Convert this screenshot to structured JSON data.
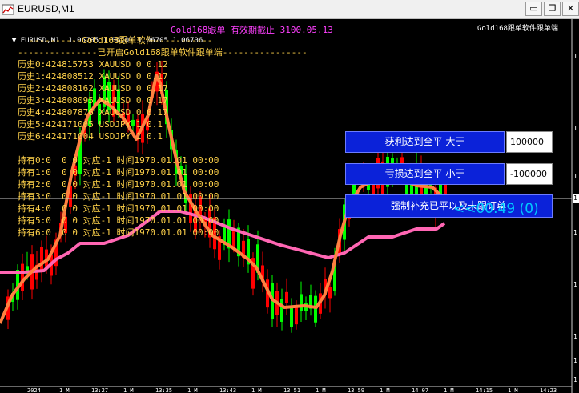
{
  "window": {
    "title": "EURUSD,M1",
    "minimize_glyph": "▭",
    "restore_glyph": "❐",
    "close_glyph": "✕"
  },
  "chart_header": {
    "symbol_info": "EURUSD,M1  1.06705 1.06707 1.06705 1.06706",
    "product_banner": "Gold168跟单 有效期截止 3100.05.13",
    "ea_name": "Gold168跟单软件跟单端"
  },
  "overlay_lines": [
    "----------Gold168跟单软件-----------",
    "---------------已开启Gold168跟单软件跟单端----------------",
    "历史0:424815753 XAUUSD 0 0.12",
    "历史1:424808512 XAUUSD 0 0.17",
    "历史2:424808162 XAUUSD 0 0.17",
    "历史3:424808095 XAUUSD 0 0.17",
    "历史4:424807876 XAUUSD 0 0.17",
    "历史5:424171005 USDJPY 1 0.1",
    "历史6:424171004 USDJPY 1 0.1",
    "",
    "持有0:0  0 0 对应-1 时间1970.01.01 00:00",
    "持有1:0  0 0 对应-1 时间1970.01.01 00:00",
    "持有2:0  0 0 对应-1 时间1970.01.01 00:00",
    "持有3:0  0 0 对应-1 时间1970.01.01 00:00",
    "持有4:0  0 0 对应-1 时间1970.01.01 00:00",
    "持有5:0  0 0 对应-1 时间1970.01.01 00:00",
    "持有6:0  0 0 对应-1 时间1970.01.01 00:00"
  ],
  "panel": {
    "tp_close_label": "获利达到全平 大于",
    "tp_close_value": "100000",
    "sl_close_label": "亏损达到全平 小于",
    "sl_close_value": "-100000",
    "force_fill_label": "强制补充已平以及未跟订单",
    "profit_display": "<<00.49 (0)"
  },
  "axis": {
    "y_ticks": [
      "1",
      "1",
      "1",
      "1",
      "1",
      "1",
      "1",
      "1"
    ],
    "current_price_label": "1",
    "x_ticks": [
      "2024",
      "1 M",
      "13:27",
      "1 M",
      "13:35",
      "1 M",
      "13:43",
      "1 M",
      "13:51",
      "1 M",
      "13:59",
      "1 M",
      "14:07",
      "1 M",
      "14:15",
      "1 M",
      "14:23"
    ]
  },
  "colors": {
    "background": "#000000",
    "bull_candle": "#00ff00",
    "bear_candle": "#ff0000",
    "fast_ma": "#ff8040",
    "slow_ma": "#ff66b3",
    "text": "#ffd24a",
    "banner": "#ff40ff",
    "button": "#0b22d9",
    "profit_text": "#00c8ff"
  },
  "icons": [
    "chart-app-icon",
    "minimize-icon",
    "restore-icon",
    "close-icon"
  ]
}
